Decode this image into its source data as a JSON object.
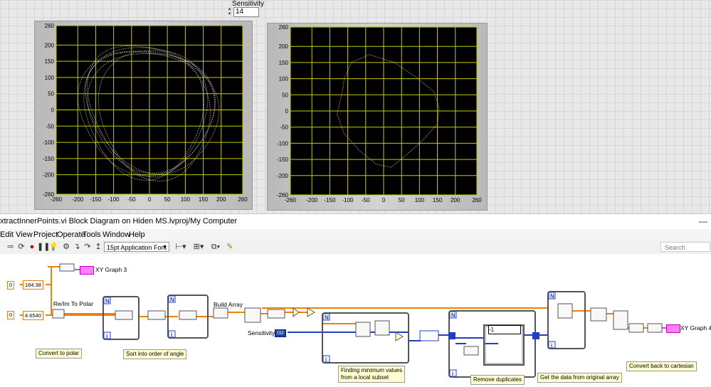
{
  "front_panel": {
    "sensitivity": {
      "label": "Sensitivity",
      "value": "14"
    },
    "graph_ticks": [
      "260",
      "200",
      "150",
      "100",
      "50",
      "0",
      "-50",
      "-100",
      "-150",
      "-200",
      "-260"
    ],
    "x_ticks": [
      "-260",
      "-200",
      "-150",
      "-100",
      "-50",
      "0",
      "50",
      "100",
      "150",
      "200",
      "260"
    ],
    "colors": {
      "plot_bg": "#000000",
      "grid": "#c8c800",
      "trace": "#d8d8d8"
    }
  },
  "window": {
    "title": "xtractInnerPoints.vi Block Diagram on Hiden MS.lvproj/My Computer",
    "minimize": "—"
  },
  "menu": [
    "Edit",
    "View",
    "Project",
    "Operate",
    "Tools",
    "Window",
    "Help"
  ],
  "toolbar": {
    "font": "15pt Application Font",
    "search_placeholder": "Search",
    "icons": [
      "run-arrow-icon",
      "run-continuous-icon",
      "abort-icon",
      "pause-icon",
      "highlight-bulb-icon",
      "retain-wire-icon",
      "step-into-icon",
      "step-over-icon",
      "step-out-icon",
      "align-icon",
      "distribute-icon",
      "resize-icon",
      "reorder-icon",
      "cleanup-icon"
    ]
  },
  "diagram": {
    "labels": {
      "xy_graph_3": "XY Graph 3",
      "xy_graph_4": "XY Graph 4",
      "re_im_to_polar": "Re/Im To Polar",
      "build_array": "Build Array",
      "sensitivity": "Sensitivity",
      "neg_one": "-1",
      "zero_a": "0",
      "zero_b": "0",
      "val_a": "184.38",
      "val_b": "4.6540",
      "loop_n": "N",
      "loop_i": "i"
    },
    "comments": {
      "convert_polar": "Convert to polar",
      "sort": "Sort into order of angle",
      "finding_line1": "Finding minimum values",
      "finding_line2": "from a local subset",
      "remove_dup": "Remove duplicates",
      "get_data": "Get the data from original array",
      "convert_back": "Convert back to cartesian"
    },
    "i32_value": "I32"
  }
}
